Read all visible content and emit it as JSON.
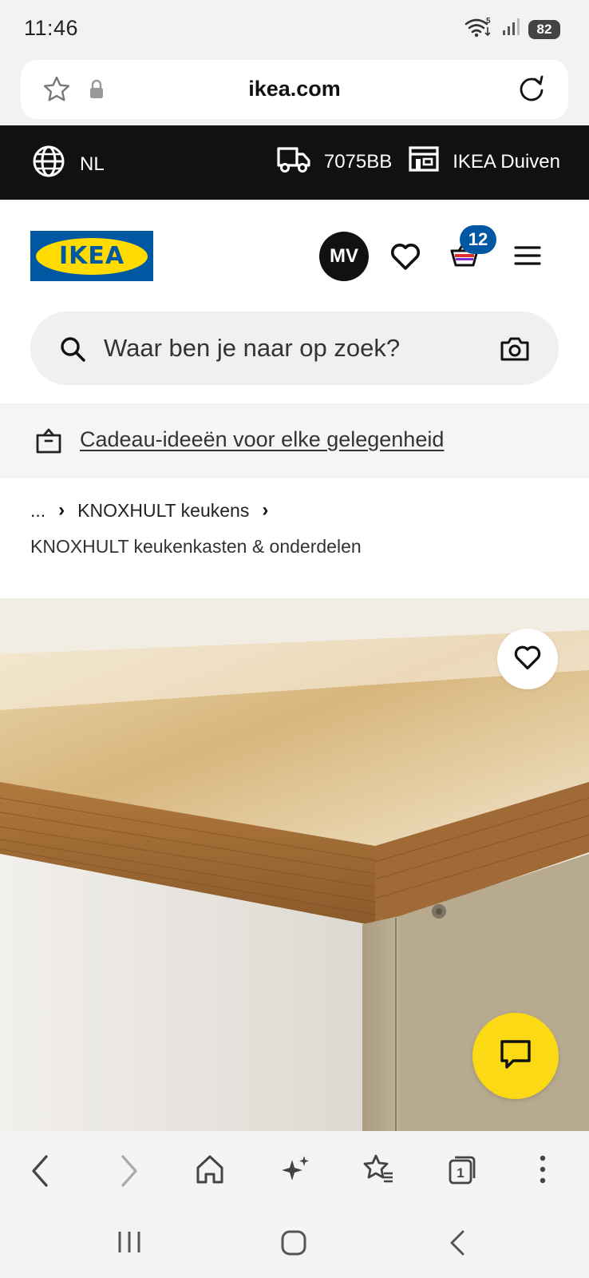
{
  "status_bar": {
    "time": "11:46",
    "wifi_label": "5",
    "battery": "82"
  },
  "browser": {
    "url": "ikea.com",
    "tab_count": "1"
  },
  "top_strip": {
    "language": "NL",
    "postcode": "7075BB",
    "store": "IKEA Duiven"
  },
  "header": {
    "logo_text": "IKEA",
    "avatar_initials": "MV",
    "cart_count": "12"
  },
  "search": {
    "placeholder": "Waar ben je naar op zoek?"
  },
  "promo": {
    "link_text": "Cadeau-ideeën voor elke gelegenheid"
  },
  "breadcrumb": {
    "ellipsis": "...",
    "parent": "KNOXHULT keukens",
    "current": "KNOXHULT keukenkasten & onderdelen"
  },
  "colors": {
    "ikea_blue": "#0058a3",
    "ikea_yellow": "#ffdb00",
    "chat_yellow": "#fbd914",
    "strip_black": "#111111"
  },
  "icons": {
    "url_bar": [
      "star-icon",
      "lock-icon",
      "reload-icon"
    ],
    "strip": [
      "globe-icon",
      "truck-icon",
      "store-icon"
    ],
    "header": [
      "heart-icon",
      "cart-icon",
      "menu-icon",
      "search-icon",
      "camera-icon"
    ],
    "browser_nav": [
      "back-icon",
      "forward-icon",
      "home-icon",
      "sparkle-icon",
      "bookmarks-icon",
      "tabs-icon",
      "more-icon"
    ],
    "system_nav": [
      "recents-icon",
      "home-button-icon",
      "system-back-icon"
    ]
  }
}
